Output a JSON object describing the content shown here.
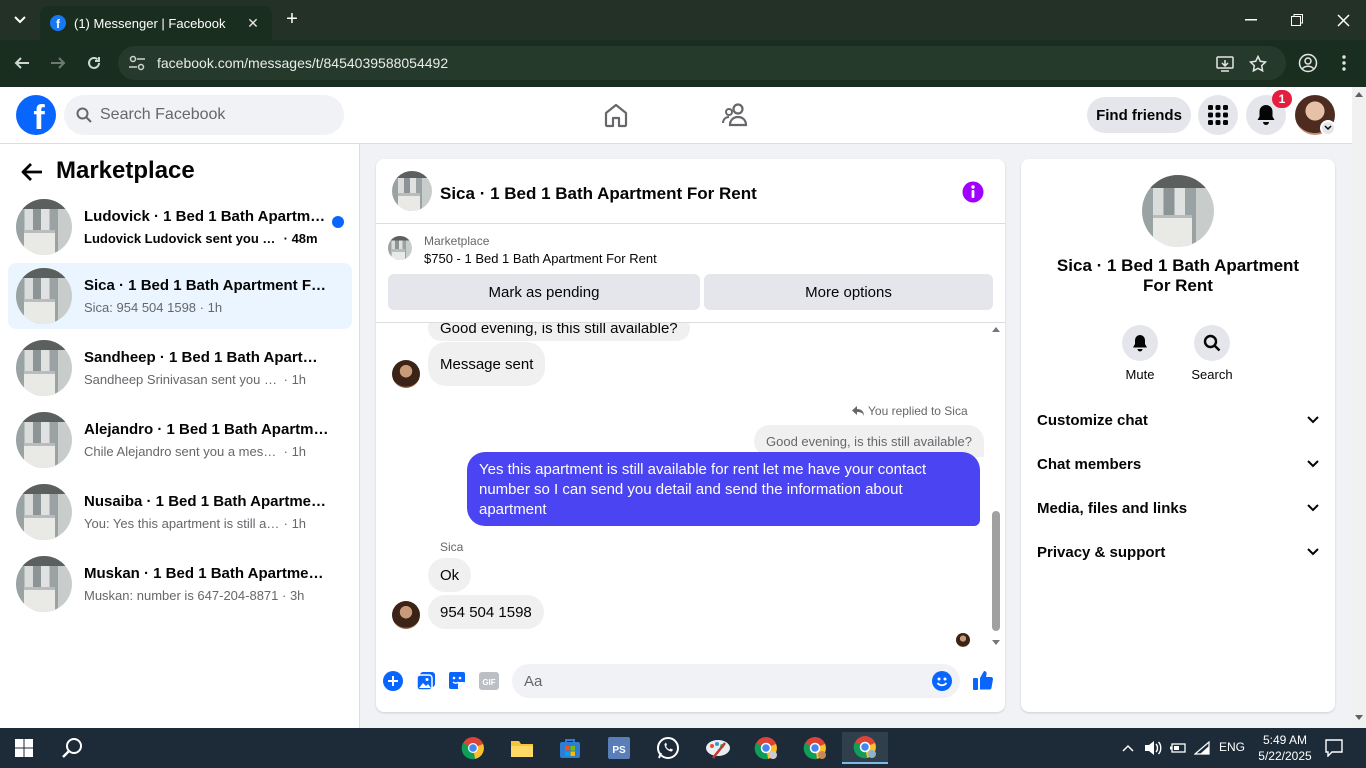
{
  "browser": {
    "tab_title": "(1) Messenger | Facebook",
    "url": "facebook.com/messages/t/8454039588054492"
  },
  "fb_header": {
    "logo": "f",
    "search_placeholder": "Search Facebook",
    "find_friends": "Find friends",
    "notification_count": "1"
  },
  "sidebar": {
    "title": "Marketplace",
    "conversations": [
      {
        "name": "Ludovick · 1 Bed 1 Bath Apartme...",
        "snippet": "Ludovick Ludovick sent you a me...",
        "time": "48m",
        "unread": true
      },
      {
        "name": "Sica · 1 Bed 1 Bath Apartment For ...",
        "snippet": "Sica: 954 504 1598",
        "time": "1h",
        "active": true
      },
      {
        "name": "Sandheep · 1 Bed 1 Bath Apartmen...",
        "snippet": "Sandheep Srinivasan sent you a mess...",
        "time": "1h"
      },
      {
        "name": "Alejandro · 1 Bed 1 Bath Apartmen...",
        "snippet": "Chile Alejandro sent you a message a...",
        "time": "1h"
      },
      {
        "name": "Nusaiba · 1 Bed 1 Bath Apartment ...",
        "snippet": "You: Yes this apartment is still availabl...",
        "time": "1h"
      },
      {
        "name": "Muskan · 1 Bed 1 Bath Apartment ...",
        "snippet": "Muskan: number is 647-204-8871",
        "time": "3h"
      }
    ]
  },
  "chat": {
    "title": "Sica · 1 Bed 1 Bath Apartment For Rent",
    "listing_label": "Marketplace",
    "listing_price": "$750 - 1 Bed 1 Bath Apartment For Rent",
    "mark_pending": "Mark as pending",
    "more_options": "More options",
    "messages": {
      "m1": "Good evening, is this still available?",
      "m2": "Message sent",
      "replied_label": "You replied to Sica",
      "quoted": "Good evening, is this still available?",
      "mine": "Yes this apartment is still available for rent let me have your contact number so I can send you detail and send the information about apartment",
      "sender": "Sica",
      "m3": "Ok",
      "m4": "954 504 1598"
    },
    "input_placeholder": "Aa"
  },
  "info_panel": {
    "title": "Sica · 1 Bed 1 Bath Apartment For Rent",
    "mute": "Mute",
    "search": "Search",
    "sections": [
      "Customize chat",
      "Chat members",
      "Media, files and links",
      "Privacy & support"
    ]
  },
  "taskbar": {
    "lang": "ENG",
    "time": "5:49 AM",
    "date": "5/22/2025"
  },
  "colors": {
    "fb_blue": "#0866ff",
    "my_bubble": "#4a44f2",
    "browser_frame": "#1a2e1f",
    "badge_red": "#e41e3f"
  }
}
